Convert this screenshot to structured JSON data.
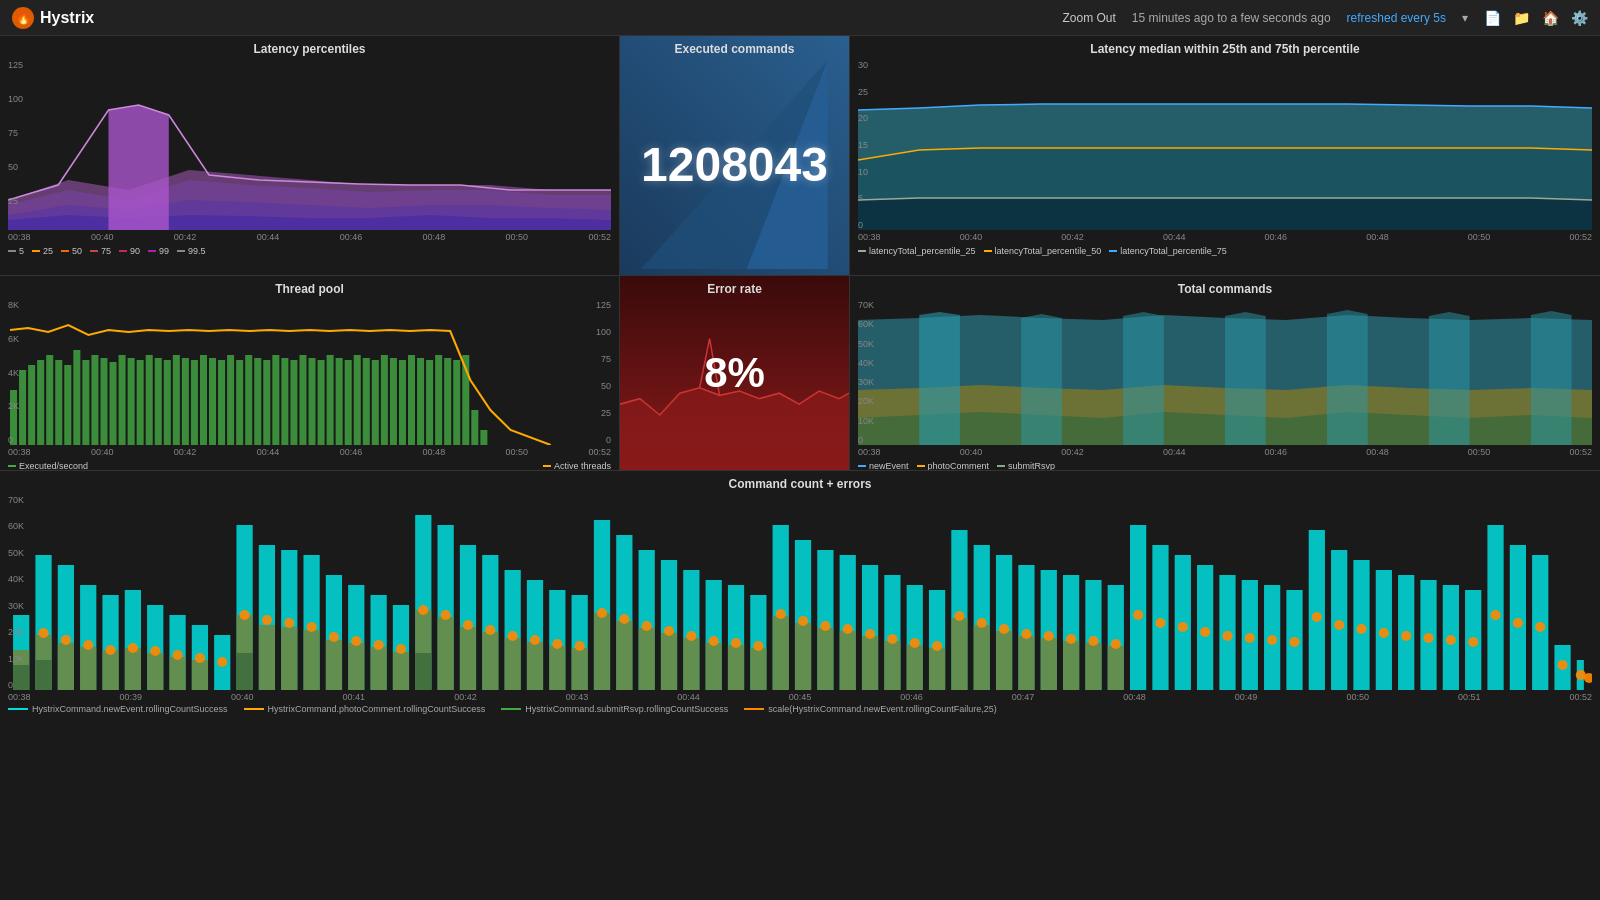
{
  "header": {
    "logo": "Hystrix",
    "logo_icon": "🔥",
    "zoom_out": "Zoom Out",
    "time_range": "15 minutes ago to a few seconds ago",
    "refresh_text": "refreshed every 5s",
    "icons": [
      "📄",
      "📁",
      "🏠",
      "⚙️"
    ]
  },
  "panels": {
    "latency_percentiles": {
      "title": "Latency percentiles",
      "y_labels": [
        "125",
        "100",
        "75",
        "50",
        "25"
      ],
      "x_labels": [
        "00:38",
        "00:40",
        "00:42",
        "00:44",
        "00:46",
        "00:48",
        "00:50",
        "00:52"
      ],
      "legend": [
        {
          "label": "5",
          "color": "#888"
        },
        {
          "label": "25",
          "color": "#f90"
        },
        {
          "label": "50",
          "color": "#f60"
        },
        {
          "label": "75",
          "color": "#c44"
        },
        {
          "label": "90",
          "color": "#c26"
        },
        {
          "label": "99",
          "color": "#a2a"
        },
        {
          "label": "99.5",
          "color": "#888"
        }
      ]
    },
    "executed_commands": {
      "title": "Executed commands",
      "value": "1208043"
    },
    "latency_median": {
      "title": "Latency median within 25th and 75th percentile",
      "y_labels": [
        "30",
        "25",
        "20",
        "15",
        "10",
        "5",
        "0"
      ],
      "x_labels": [
        "00:38",
        "00:40",
        "00:42",
        "00:44",
        "00:46",
        "00:48",
        "00:50",
        "00:52"
      ],
      "legend": [
        {
          "label": "latencyTotal_percentile_25",
          "color": "#9a9"
        },
        {
          "label": "latencyTotal_percentile_50",
          "color": "#fa0"
        },
        {
          "label": "latencyTotal_percentile_75",
          "color": "#4af"
        }
      ]
    },
    "thread_pool": {
      "title": "Thread pool",
      "y_labels_left": [
        "8K",
        "6K",
        "4K",
        "2K",
        "0"
      ],
      "y_labels_right": [
        "125",
        "100",
        "75",
        "50",
        "25",
        "0"
      ],
      "x_labels": [
        "00:38",
        "00:40",
        "00:42",
        "00:44",
        "00:46",
        "00:48",
        "00:50",
        "00:52"
      ],
      "legend": [
        {
          "label": "Executed/second",
          "color": "#4a4"
        },
        {
          "label": "Active threads",
          "color": "#fa0"
        }
      ]
    },
    "error_rate": {
      "title": "Error rate",
      "value": "8%"
    },
    "total_commands": {
      "title": "Total commands",
      "y_labels": [
        "70K",
        "60K",
        "50K",
        "40K",
        "30K",
        "20K",
        "10K",
        "0"
      ],
      "x_labels": [
        "00:38",
        "00:40",
        "00:42",
        "00:44",
        "00:46",
        "00:48",
        "00:50",
        "00:52"
      ],
      "legend": [
        {
          "label": "newEvent",
          "color": "#4af"
        },
        {
          "label": "photoComment",
          "color": "#fa0"
        },
        {
          "label": "submitRsvp",
          "color": "#8a8"
        }
      ]
    },
    "command_count": {
      "title": "Command count + errors",
      "y_labels": [
        "70K",
        "60K",
        "50K",
        "40K",
        "30K",
        "20K",
        "10K",
        "0"
      ],
      "x_labels": [
        "00:38",
        "00:39",
        "00:40",
        "00:41",
        "00:42",
        "00:43",
        "00:44",
        "00:45",
        "00:46",
        "00:47",
        "00:48",
        "00:49",
        "00:50",
        "00:51",
        "00:52"
      ],
      "legend": [
        {
          "label": "HystrixCommand.newEvent.rollingCountSuccess",
          "color": "#0dd"
        },
        {
          "label": "HystrixCommand.photoComment.rollingCountSuccess",
          "color": "#fa0"
        },
        {
          "label": "HystrixCommand.submitRsvp.rollingCountSuccess",
          "color": "#4a4"
        },
        {
          "label": "scale(HystrixCommand.newEvent.rollingCountFailure,25)",
          "color": "#f80"
        }
      ]
    }
  }
}
